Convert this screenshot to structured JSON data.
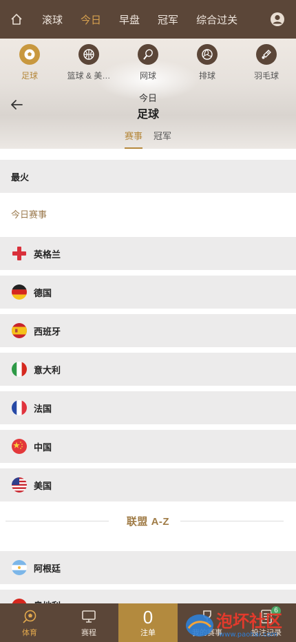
{
  "topnav": {
    "tabs": [
      "滚球",
      "今日",
      "早盘",
      "冠军",
      "综合过关"
    ],
    "active": "今日"
  },
  "sports": [
    {
      "label": "足球",
      "icon": "soccer-ball-icon",
      "active": true
    },
    {
      "label": "篮球 & 美…",
      "icon": "basketball-icon",
      "active": false
    },
    {
      "label": "网球",
      "icon": "tennis-icon",
      "active": false
    },
    {
      "label": "排球",
      "icon": "volleyball-icon",
      "active": false
    },
    {
      "label": "羽毛球",
      "icon": "badminton-icon",
      "active": false
    }
  ],
  "header": {
    "subtitle": "今日",
    "title": "足球"
  },
  "segments": {
    "events": "赛事",
    "champion": "冠军",
    "active": "赛事"
  },
  "sections": {
    "hot": "最火",
    "today": "今日赛事",
    "az": "联盟 A-Z"
  },
  "countries": [
    {
      "name": "英格兰",
      "flag": "england"
    },
    {
      "name": "德国",
      "flag": "germany"
    },
    {
      "name": "西班牙",
      "flag": "spain"
    },
    {
      "name": "意大利",
      "flag": "italy"
    },
    {
      "name": "法国",
      "flag": "france"
    },
    {
      "name": "中国",
      "flag": "china"
    },
    {
      "name": "美国",
      "flag": "usa"
    }
  ],
  "leagues": [
    {
      "name": "阿根廷",
      "flag": "argentina"
    },
    {
      "name": "奥地利",
      "flag": "austria"
    }
  ],
  "bottom": {
    "sports": "体育",
    "schedule": "赛程",
    "bet_count": "0",
    "bet_slip": "注单",
    "my_bets": "我的赛事",
    "records": "投注记录",
    "records_badge": "6"
  },
  "watermark": {
    "text": "泡坏社区",
    "url": "www.paohai.com"
  }
}
